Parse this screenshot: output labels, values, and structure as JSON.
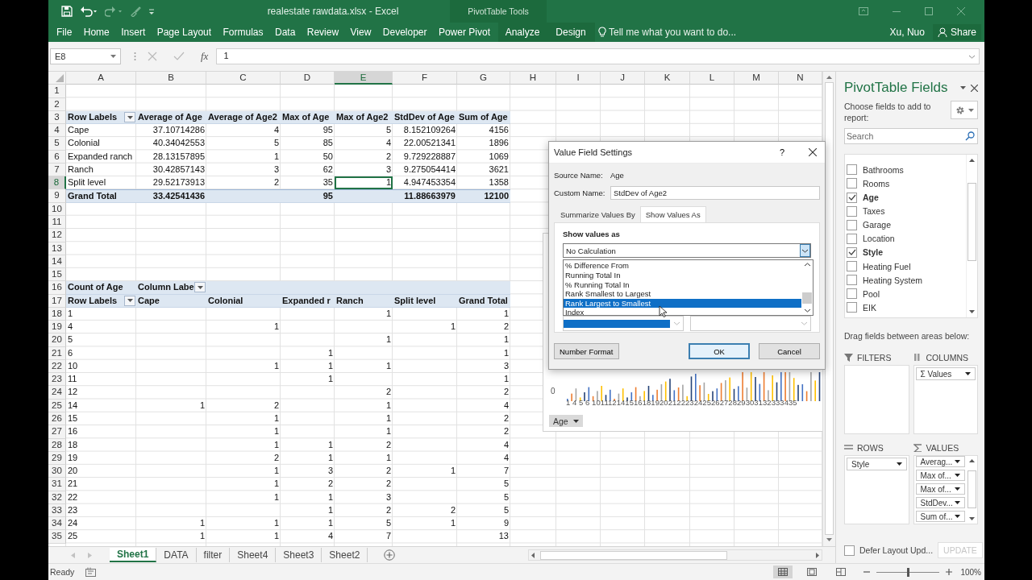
{
  "title_bar": {
    "title": "realestate rawdata.xlsx - Excel",
    "context_title": "PivotTable Tools"
  },
  "ribbon_tabs": [
    {
      "label": "File",
      "contextual": false
    },
    {
      "label": "Home",
      "contextual": false
    },
    {
      "label": "Insert",
      "contextual": false
    },
    {
      "label": "Page Layout",
      "contextual": false
    },
    {
      "label": "Formulas",
      "contextual": false
    },
    {
      "label": "Data",
      "contextual": false
    },
    {
      "label": "Review",
      "contextual": false
    },
    {
      "label": "View",
      "contextual": false
    },
    {
      "label": "Developer",
      "contextual": false
    },
    {
      "label": "Power Pivot",
      "contextual": false
    },
    {
      "label": "Analyze",
      "contextual": true
    },
    {
      "label": "Design",
      "contextual": true
    }
  ],
  "tell_me": {
    "placeholder": "Tell me what you want to do..."
  },
  "user": "Xu, Nuo",
  "share_button": "Share",
  "formula_bar": {
    "name_box": "E8",
    "function_label": "fx",
    "value": "1"
  },
  "sheet": {
    "columns": [
      {
        "label": "A",
        "selected": false
      },
      {
        "label": "B",
        "selected": false
      },
      {
        "label": "C",
        "selected": false
      },
      {
        "label": "D",
        "selected": false
      },
      {
        "label": "E",
        "selected": true
      },
      {
        "label": "F",
        "selected": false
      },
      {
        "label": "G",
        "selected": false
      },
      {
        "label": "H",
        "selected": false
      },
      {
        "label": "I",
        "selected": false
      },
      {
        "label": "J",
        "selected": false
      },
      {
        "label": "K",
        "selected": false
      },
      {
        "label": "L",
        "selected": false
      },
      {
        "label": "M",
        "selected": false
      },
      {
        "label": "N",
        "selected": false
      }
    ],
    "rows": [
      {
        "label": "1",
        "selected": false,
        "kind": "plain"
      },
      {
        "label": "2",
        "selected": false,
        "kind": "plain"
      },
      {
        "label": "3",
        "selected": false,
        "kind": "pivot-header",
        "cells": [
          {
            "text": "Row Labels",
            "filter": true
          },
          "Average of Age",
          "Average of Age2",
          "Max of Age",
          "Max of Age2",
          "StdDev of Age",
          "Sum of Age"
        ]
      },
      {
        "label": "4",
        "selected": false,
        "kind": "plain",
        "cells": [
          "Cape",
          "37.10714286",
          "4",
          "95",
          "5",
          "8.152109264",
          "4156"
        ]
      },
      {
        "label": "5",
        "selected": false,
        "kind": "plain",
        "cells": [
          "Colonial",
          "40.34042553",
          "5",
          "85",
          "4",
          "22.00521341",
          "1896"
        ]
      },
      {
        "label": "6",
        "selected": false,
        "kind": "plain",
        "cells": [
          "Expanded ranch",
          "28.13157895",
          "1",
          "50",
          "2",
          "9.729228887",
          "1069"
        ]
      },
      {
        "label": "7",
        "selected": false,
        "kind": "plain",
        "cells": [
          "Ranch",
          "30.42857143",
          "3",
          "62",
          "3",
          "9.275054414",
          "3621"
        ]
      },
      {
        "label": "8",
        "selected": true,
        "kind": "plain",
        "cells": [
          "Split level",
          "29.52173913",
          "2",
          "35",
          "1",
          "4.947453354",
          "1358"
        ]
      },
      {
        "label": "9",
        "selected": false,
        "kind": "pivot-total",
        "cells": [
          "Grand Total",
          "33.42541436",
          null,
          "95",
          null,
          "11.88663979",
          "12100"
        ]
      },
      {
        "label": "10",
        "selected": false,
        "kind": "plain"
      },
      {
        "label": "11",
        "selected": false,
        "kind": "plain"
      },
      {
        "label": "12",
        "selected": false,
        "kind": "plain"
      },
      {
        "label": "13",
        "selected": false,
        "kind": "plain"
      },
      {
        "label": "14",
        "selected": false,
        "kind": "plain"
      },
      {
        "label": "15",
        "selected": false,
        "kind": "plain"
      },
      {
        "label": "16",
        "selected": false,
        "kind": "pivot-header",
        "cells": [
          "Count of Age",
          {
            "text": "Column Labe",
            "filter": true
          }
        ]
      },
      {
        "label": "17",
        "selected": false,
        "kind": "pivot-header",
        "cells": [
          {
            "text": "Row Labels",
            "filter": true
          },
          "Cape",
          "Colonial",
          "Expanded r",
          "Ranch",
          "Split level",
          "Grand Total"
        ]
      },
      {
        "label": "18",
        "selected": false,
        "kind": "plain",
        "cells": [
          "1",
          null,
          null,
          null,
          "1",
          null,
          "1"
        ]
      },
      {
        "label": "19",
        "selected": false,
        "kind": "plain",
        "cells": [
          "4",
          null,
          "1",
          null,
          null,
          "1",
          "2"
        ]
      },
      {
        "label": "20",
        "selected": false,
        "kind": "plain",
        "cells": [
          "5",
          null,
          null,
          null,
          "1",
          null,
          "1"
        ]
      },
      {
        "label": "21",
        "selected": false,
        "kind": "plain",
        "cells": [
          "6",
          null,
          null,
          "1",
          null,
          null,
          "1"
        ]
      },
      {
        "label": "22",
        "selected": false,
        "kind": "plain",
        "cells": [
          "10",
          null,
          "1",
          "1",
          "1",
          null,
          "3"
        ]
      },
      {
        "label": "23",
        "selected": false,
        "kind": "plain",
        "cells": [
          "11",
          null,
          null,
          "1",
          null,
          null,
          "1"
        ]
      },
      {
        "label": "24",
        "selected": false,
        "kind": "plain",
        "cells": [
          "12",
          null,
          null,
          null,
          "2",
          null,
          "2"
        ]
      },
      {
        "label": "25",
        "selected": false,
        "kind": "plain",
        "cells": [
          "14",
          "1",
          "2",
          null,
          "1",
          null,
          "4"
        ]
      },
      {
        "label": "26",
        "selected": false,
        "kind": "plain",
        "cells": [
          "15",
          null,
          "1",
          null,
          "1",
          null,
          "2"
        ]
      },
      {
        "label": "27",
        "selected": false,
        "kind": "plain",
        "cells": [
          "16",
          null,
          "1",
          null,
          "1",
          null,
          "2"
        ]
      },
      {
        "label": "28",
        "selected": false,
        "kind": "plain",
        "cells": [
          "18",
          null,
          "1",
          "1",
          "2",
          null,
          "4"
        ]
      },
      {
        "label": "29",
        "selected": false,
        "kind": "plain",
        "cells": [
          "19",
          null,
          "2",
          "1",
          "1",
          null,
          "4"
        ]
      },
      {
        "label": "30",
        "selected": false,
        "kind": "plain",
        "cells": [
          "20",
          null,
          "1",
          "3",
          "2",
          "1",
          "7"
        ]
      },
      {
        "label": "31",
        "selected": false,
        "kind": "plain",
        "cells": [
          "21",
          null,
          "1",
          "2",
          "2",
          null,
          "5"
        ]
      },
      {
        "label": "32",
        "selected": false,
        "kind": "plain",
        "cells": [
          "22",
          null,
          "1",
          "1",
          "3",
          null,
          "5"
        ]
      },
      {
        "label": "33",
        "selected": false,
        "kind": "plain",
        "cells": [
          "23",
          null,
          null,
          "1",
          "2",
          "2",
          "5"
        ]
      },
      {
        "label": "34",
        "selected": false,
        "kind": "plain",
        "cells": [
          "24",
          "1",
          "1",
          "1",
          "5",
          "1",
          "9"
        ]
      },
      {
        "label": "35",
        "selected": false,
        "kind": "plain",
        "cells": [
          "25",
          "1",
          "1",
          "4",
          "7",
          null,
          "13"
        ]
      }
    ]
  },
  "chart": {
    "axis_zero": "0",
    "x_axis_labels": "1 4 5 6 101112141516181920212223242526272829303132333435",
    "field_button": "Age"
  },
  "dialog": {
    "title": "Value Field Settings",
    "help": "?",
    "source_label": "Source Name:",
    "source_value": "Age",
    "custom_label": "Custom Name:",
    "custom_value": "StdDev of Age2",
    "tabs": [
      {
        "label": "Summarize Values By",
        "selected": false
      },
      {
        "label": "Show Values As",
        "selected": true
      }
    ],
    "section_label": "Show values as",
    "combo_value": "No Calculation",
    "options": [
      {
        "label": "% Difference From",
        "selected": false
      },
      {
        "label": "Running Total In",
        "selected": false
      },
      {
        "label": "% Running Total In",
        "selected": false
      },
      {
        "label": "Rank Smallest to Largest",
        "selected": false
      },
      {
        "label": "Rank Largest to Smallest",
        "selected": true
      },
      {
        "label": "Index",
        "selected": false
      }
    ],
    "buttons": [
      {
        "label": "Number Format",
        "default": false
      },
      {
        "label": "OK",
        "default": true
      },
      {
        "label": "Cancel",
        "default": false
      }
    ]
  },
  "field_pane": {
    "title": "PivotTable Fields",
    "hint": "Choose fields to add to report:",
    "search": {
      "placeholder": "Search"
    },
    "fields": [
      {
        "label": "Bathrooms",
        "checked": false
      },
      {
        "label": "Rooms",
        "checked": false
      },
      {
        "label": "Age",
        "checked": true
      },
      {
        "label": "Taxes",
        "checked": false
      },
      {
        "label": "Garage",
        "checked": false
      },
      {
        "label": "Location",
        "checked": false
      },
      {
        "label": "Style",
        "checked": true
      },
      {
        "label": "Heating Fuel",
        "checked": false
      },
      {
        "label": "Heating System",
        "checked": false
      },
      {
        "label": "Pool",
        "checked": false
      },
      {
        "label": "EIK",
        "checked": false
      }
    ],
    "areas_hint": "Drag fields between areas below:",
    "areas": [
      {
        "kind": "filters",
        "label": "FILTERS"
      },
      {
        "kind": "columns",
        "label": "COLUMNS",
        "items": [
          "Σ Values"
        ]
      },
      {
        "kind": "rows",
        "label": "ROWS",
        "items": [
          "Style"
        ]
      },
      {
        "kind": "values",
        "label": "VALUES",
        "items": [
          "Averag...",
          "Max of...",
          "Max of...",
          "StdDev...",
          "Sum of..."
        ]
      }
    ],
    "defer": {
      "label": "Defer Layout Upd...",
      "checked": false
    },
    "update_button": {
      "label": "UPDATE",
      "disabled": true
    }
  },
  "sheet_tabs": [
    {
      "label": "Sheet1",
      "selected": true
    },
    {
      "label": "DATA",
      "selected": false
    },
    {
      "label": "filter",
      "selected": false
    },
    {
      "label": "Sheet4",
      "selected": false
    },
    {
      "label": "Sheet3",
      "selected": false
    },
    {
      "label": "Sheet2",
      "selected": false
    }
  ],
  "status": {
    "text": "Ready",
    "view_modes": [
      {
        "kind": "normal",
        "selected": true
      },
      {
        "kind": "page-layout",
        "selected": false
      },
      {
        "kind": "page-break",
        "selected": false
      }
    ],
    "zoom": {
      "level": 0.5,
      "label": "100%"
    }
  }
}
